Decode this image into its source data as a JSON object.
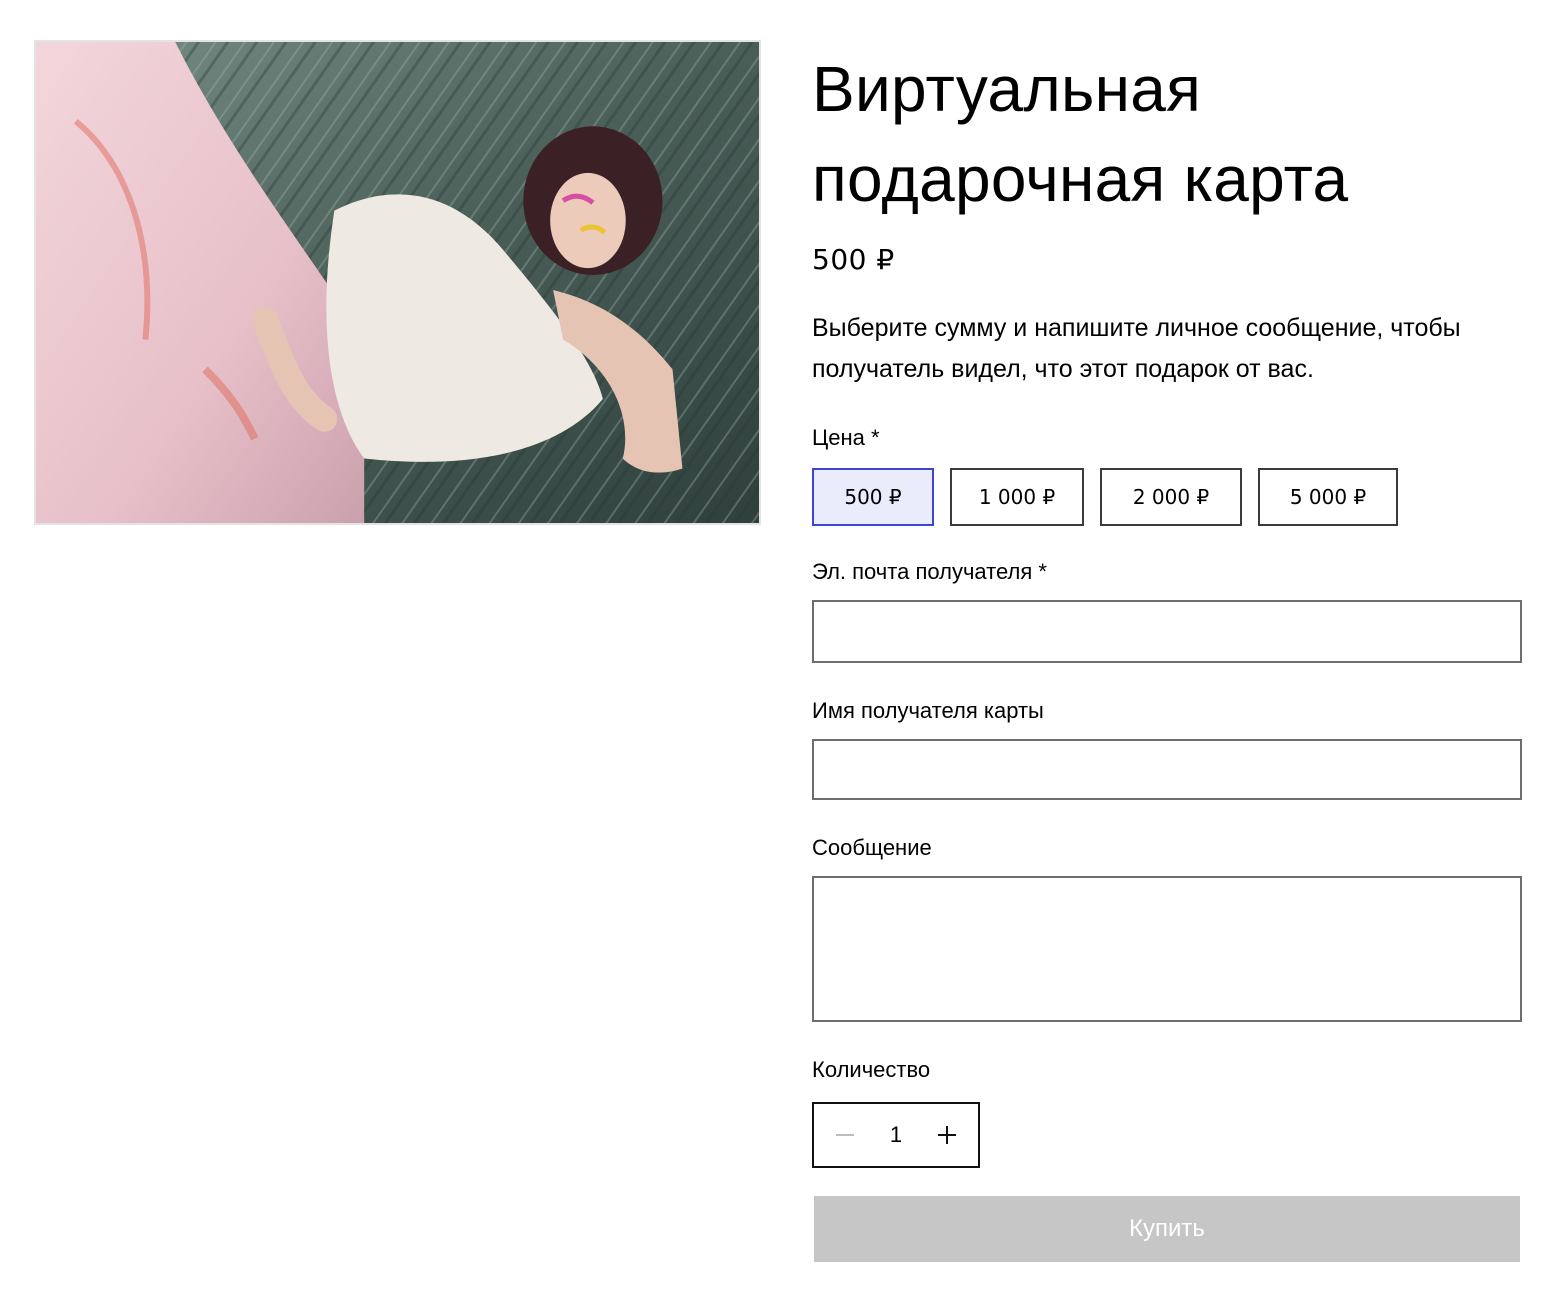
{
  "product": {
    "title_line1": "Виртуальная",
    "title_line2": "подарочная карта",
    "price": "500 ₽",
    "description_line1": "Выберите сумму и напишите личное сообщение, чтобы",
    "description_line2": "получатель видел, что этот подарок от вас.",
    "image_icon": "product-photo"
  },
  "price_selector": {
    "label": "Цена *",
    "options": [
      "500 ₽",
      "1 000 ₽",
      "2 000 ₽",
      "5 000 ₽"
    ],
    "selected": "500 ₽",
    "selected_color": "#3c46d4"
  },
  "form": {
    "email_label": "Эл. почта получателя *",
    "email_value": "",
    "name_label": "Имя получателя карты",
    "name_value": "",
    "message_label": "Сообщение",
    "message_value": ""
  },
  "quantity": {
    "label": "Количество",
    "value": "1",
    "minus_icon": "minus-icon",
    "plus_icon": "plus-icon"
  },
  "buy_button": {
    "label": "Купить",
    "state": "disabled",
    "color": "#c6c6c6"
  }
}
